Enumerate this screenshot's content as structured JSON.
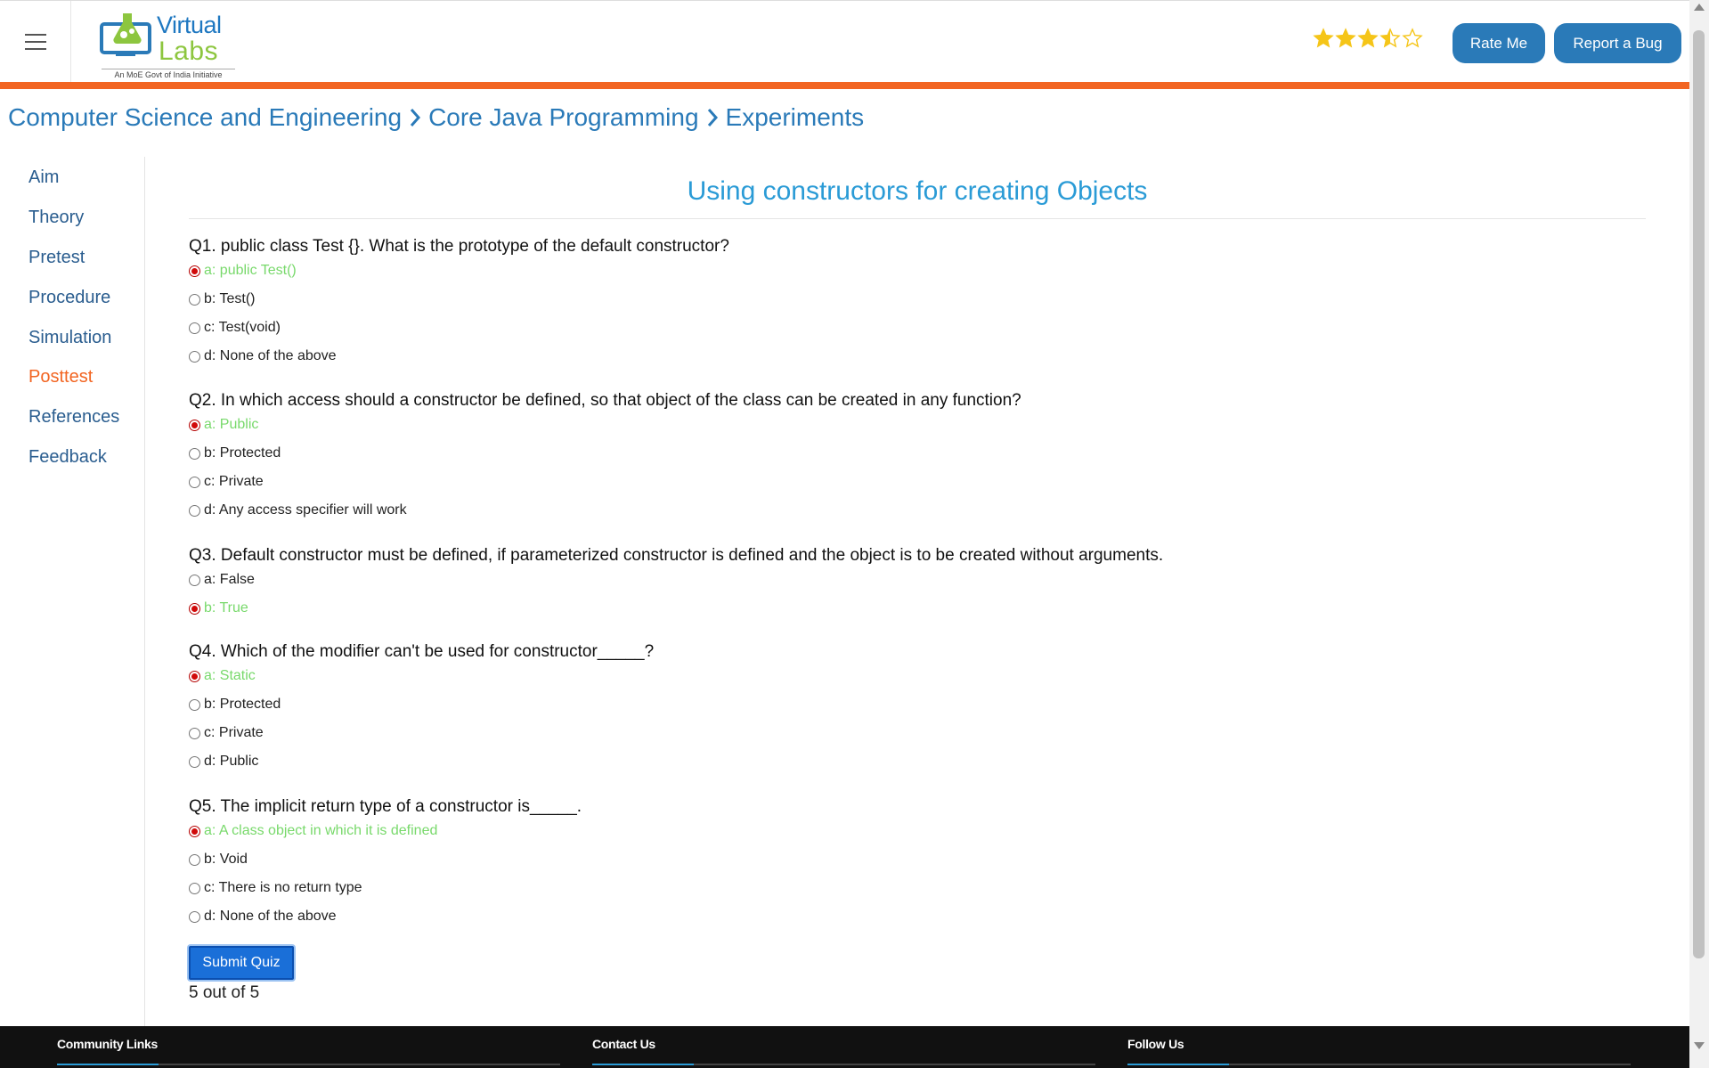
{
  "header": {
    "logo": {
      "word1": "Virtual",
      "word2": "Labs",
      "tagline": "An MoE Govt of India Initiative"
    },
    "rating": {
      "value": 3.5,
      "max": 5,
      "color": "#f5c518"
    },
    "rate_me_label": "Rate Me",
    "report_bug_label": "Report a Bug",
    "accent_color": "#f26522"
  },
  "breadcrumb": [
    "Computer Science and Engineering",
    "Core Java Programming",
    "Experiments"
  ],
  "sidebar": {
    "items": [
      {
        "label": "Aim",
        "active": false
      },
      {
        "label": "Theory",
        "active": false
      },
      {
        "label": "Pretest",
        "active": false
      },
      {
        "label": "Procedure",
        "active": false
      },
      {
        "label": "Simulation",
        "active": false
      },
      {
        "label": "Posttest",
        "active": true
      },
      {
        "label": "References",
        "active": false
      },
      {
        "label": "Feedback",
        "active": false
      }
    ]
  },
  "main": {
    "title": "Using constructors for creating Objects",
    "questions": [
      {
        "text": "Q1. public class Test {}. What is the prototype of the default constructor?",
        "options": [
          {
            "text": "a: public Test()",
            "selected": true,
            "correct": true
          },
          {
            "text": "b: Test()",
            "selected": false,
            "correct": false
          },
          {
            "text": "c: Test(void)",
            "selected": false,
            "correct": false
          },
          {
            "text": "d: None of the above",
            "selected": false,
            "correct": false
          }
        ]
      },
      {
        "text": "Q2. In which access should a constructor be defined, so that object of the class can be created in any function?",
        "options": [
          {
            "text": "a: Public",
            "selected": true,
            "correct": true
          },
          {
            "text": "b: Protected",
            "selected": false,
            "correct": false
          },
          {
            "text": "c: Private",
            "selected": false,
            "correct": false
          },
          {
            "text": "d: Any access specifier will work",
            "selected": false,
            "correct": false
          }
        ]
      },
      {
        "text": "Q3. Default constructor must be defined, if parameterized constructor is defined and the object is to be created without arguments.",
        "options": [
          {
            "text": "a: False",
            "selected": false,
            "correct": false
          },
          {
            "text": "b: True",
            "selected": true,
            "correct": true
          }
        ]
      },
      {
        "text": "Q4. Which of the modifier can't be used for constructor_____?",
        "options": [
          {
            "text": "a: Static",
            "selected": true,
            "correct": true
          },
          {
            "text": "b: Protected",
            "selected": false,
            "correct": false
          },
          {
            "text": "c: Private",
            "selected": false,
            "correct": false
          },
          {
            "text": "d: Public",
            "selected": false,
            "correct": false
          }
        ]
      },
      {
        "text": "Q5. The implicit return type of a constructor is_____.",
        "options": [
          {
            "text": "a: A class object in which it is defined",
            "selected": true,
            "correct": true
          },
          {
            "text": "b: Void",
            "selected": false,
            "correct": false
          },
          {
            "text": "c: There is no return type",
            "selected": false,
            "correct": false
          },
          {
            "text": "d: None of the above",
            "selected": false,
            "correct": false
          }
        ]
      }
    ],
    "submit_label": "Submit Quiz",
    "score_text": "5 out of 5",
    "correct_color": "#78d96b"
  },
  "footer": {
    "columns": [
      "Community Links",
      "Contact Us",
      "Follow Us"
    ]
  }
}
